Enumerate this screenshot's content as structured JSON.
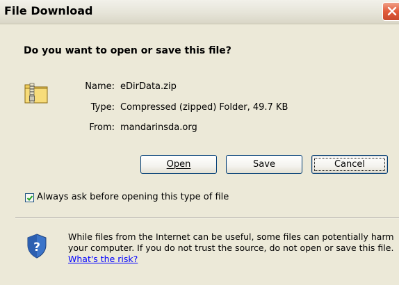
{
  "window": {
    "title": "File Download",
    "close_icon": "close-icon"
  },
  "dialog": {
    "question": "Do you want to open or save this file?",
    "file_icon": "zip-folder-icon",
    "fields": {
      "name_label": "Name:",
      "name_value": "eDirData.zip",
      "type_label": "Type:",
      "type_value": "Compressed (zipped) Folder, 49.7 KB",
      "from_label": "From:",
      "from_value": "mandarinsda.org"
    },
    "buttons": {
      "open_label": "Open",
      "save_label": "Save",
      "cancel_label": "Cancel"
    },
    "checkbox": {
      "label": "Always ask before opening this type of file",
      "checked": true
    },
    "warning": {
      "icon": "security-shield-icon",
      "text": "While files from the Internet can be useful, some files can potentially harm your computer. If you do not trust the source, do not open or save this file.",
      "link_text": "What's the risk?"
    }
  },
  "colors": {
    "background": "#ece9d8",
    "button_border": "#003c74",
    "close_button": "#e25b3a",
    "link": "#0000ff"
  }
}
